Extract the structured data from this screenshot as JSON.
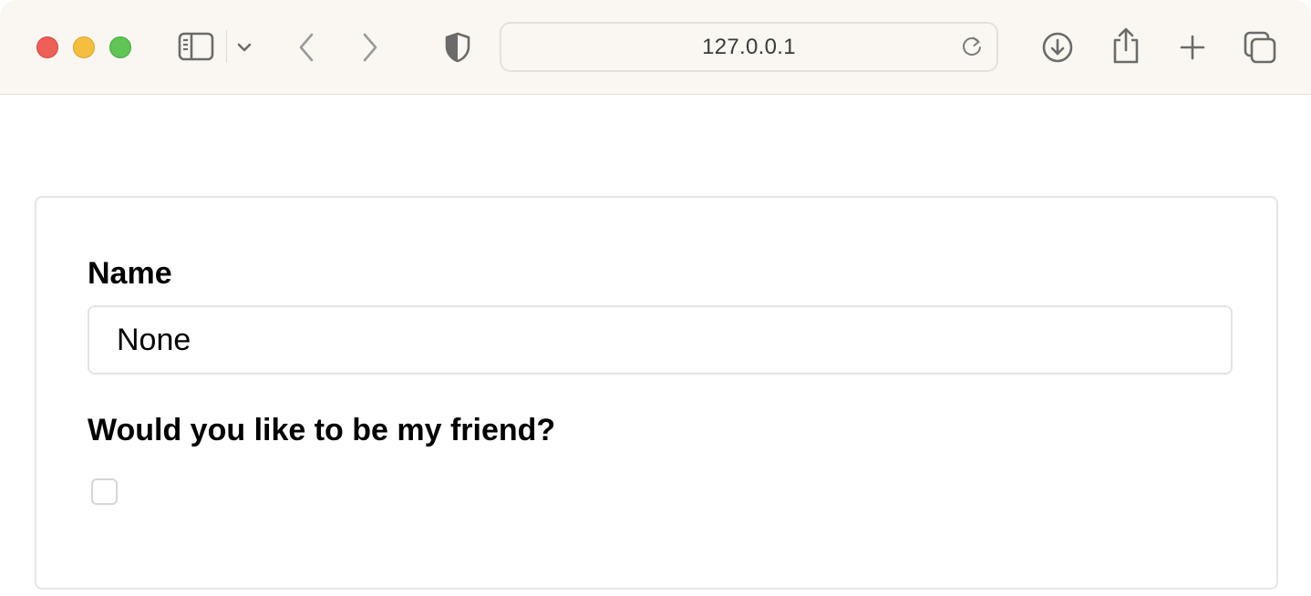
{
  "browser": {
    "address": "127.0.0.1",
    "icons": {
      "sidebar": "sidebar-icon",
      "sidebar_menu": "chevron-down-icon",
      "back": "chevron-left-icon",
      "forward": "chevron-right-icon",
      "privacy": "shield-icon",
      "reload": "reload-icon",
      "downloads": "download-icon",
      "share": "share-icon",
      "new_tab": "plus-icon",
      "tab_overview": "tabs-icon"
    },
    "colors": {
      "toolbar_bg": "#faf7f2",
      "close": "#ee5f57",
      "minimize": "#f5be3f",
      "zoom": "#5fc454"
    }
  },
  "form": {
    "name_label": "Name",
    "name_value": "None",
    "friend_label": "Would you like to be my friend?",
    "friend_checked": false
  }
}
